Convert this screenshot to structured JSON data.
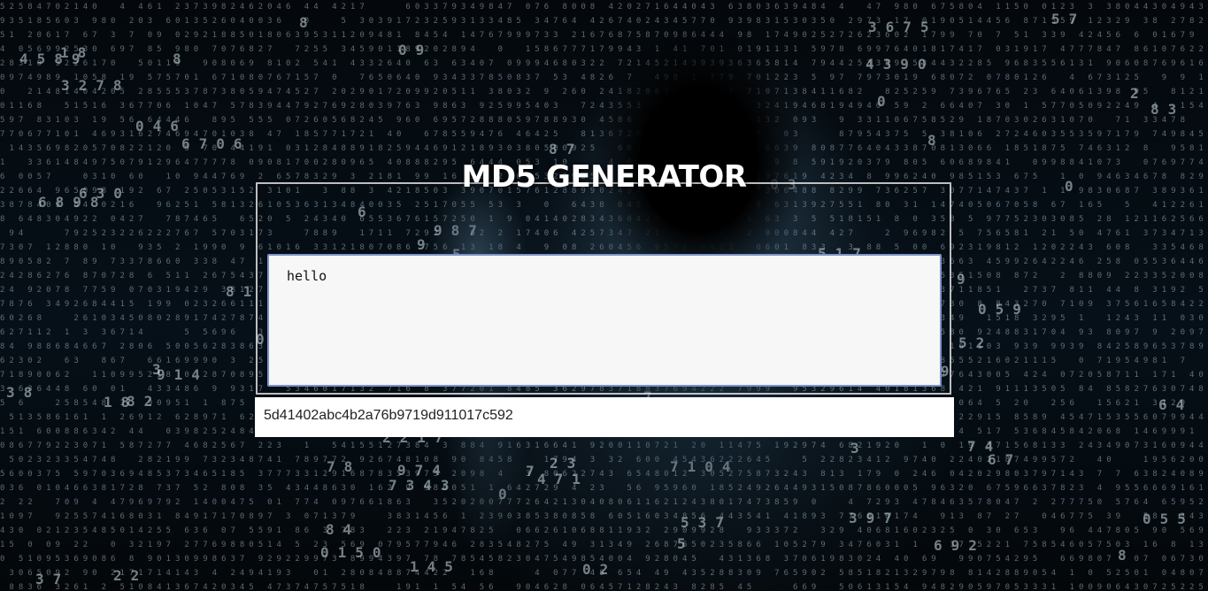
{
  "app": {
    "title": "MD5 GENERATOR"
  },
  "input": {
    "value": "hello",
    "placeholder": ""
  },
  "output": {
    "hash": "5d41402abc4b2a76b9719d911017c592"
  },
  "background": {
    "theme": "matrix digits with hooded hacker",
    "colors": {
      "base": "#04080c",
      "digits": "#c8dce6",
      "hood_glow": "#3c5a6e"
    }
  }
}
